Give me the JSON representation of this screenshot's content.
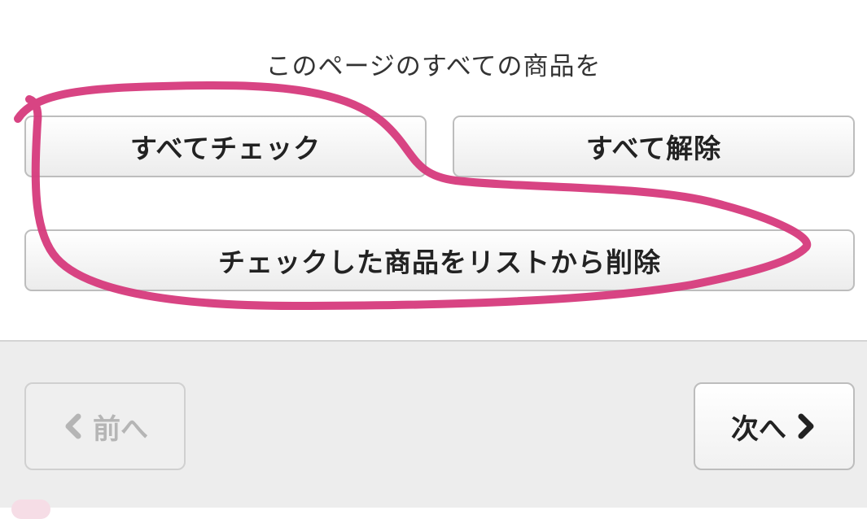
{
  "bulk_actions": {
    "heading": "このページのすべての商品を",
    "check_all_label": "すべてチェック",
    "uncheck_all_label": "すべて解除",
    "delete_checked_label": "チェックした商品をリストから削除"
  },
  "pagination": {
    "prev_label": "前へ",
    "next_label": "次へ",
    "prev_icon": "chevron-left-icon",
    "next_icon": "chevron-right-icon"
  },
  "colors": {
    "annotation_stroke": "#d63a7c",
    "disabled_text": "#b5b5b5",
    "footer_background": "#ededed"
  }
}
